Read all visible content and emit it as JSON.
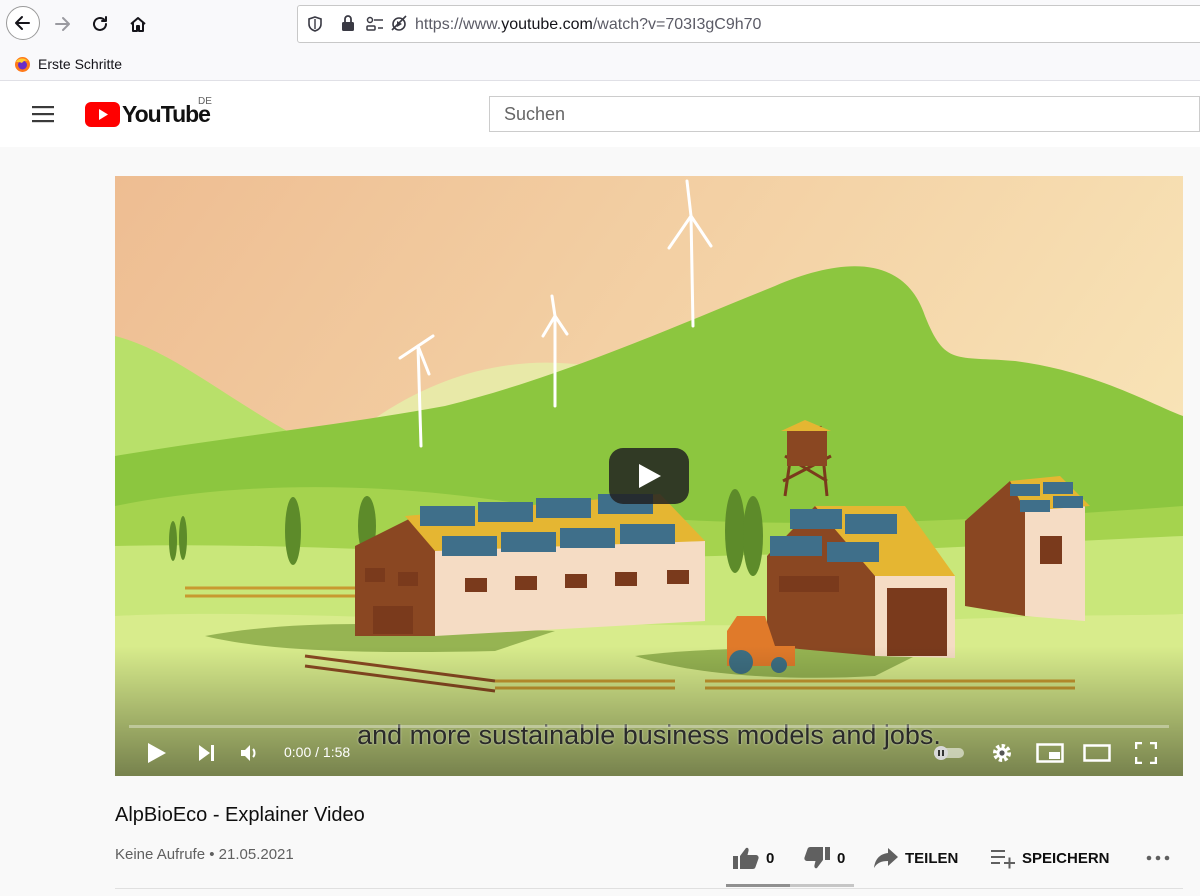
{
  "browser": {
    "url_prefix": "https://www.",
    "url_host": "youtube.com",
    "url_path": "/watch?v=703I3gC9h70",
    "bookmark_label": "Erste Schritte"
  },
  "youtube": {
    "logo_text": "YouTube",
    "country_code": "DE",
    "search_placeholder": "Suchen"
  },
  "player": {
    "caption": "and more sustainable business models and jobs.",
    "time_current": "0:00",
    "time_separator": " / ",
    "time_total": "1:58",
    "progress": 0
  },
  "video": {
    "title": "AlpBioEco - Explainer Video",
    "views": "Keine Aufrufe",
    "meta_separator": " • ",
    "date": "21.05.2021",
    "likes": "0",
    "dislikes": "0",
    "share_label": "TEILEN",
    "save_label": "SPEICHERN",
    "like_ratio": 0.5
  },
  "colors": {
    "yt_red": "#ff0000",
    "sky": "#f3c9a0",
    "hill_green": "#8cc63f"
  }
}
